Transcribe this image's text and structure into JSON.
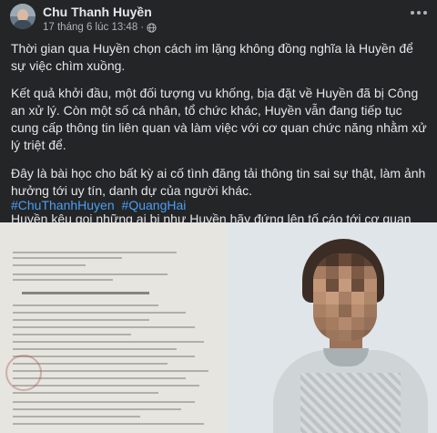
{
  "post": {
    "author": "Chu Thanh Huyền",
    "timestamp": "17 tháng 6 lúc 13:48",
    "separator": "·",
    "privacy_icon": "globe-icon",
    "more_icon": "more-horizontal-icon"
  },
  "content": {
    "paragraphs": [
      "Thời gian qua Huyền chọn cách im lặng không đồng nghĩa là Huyền để sự việc chìm xuồng.",
      "Kết quả khởi đầu, một đối tượng vu khống, bịa đặt về Huyền đã bị Công an xử lý. Còn một số cá nhân, tổ chức khác, Huyền vẫn đang tiếp tục cung cấp thông tin liên quan và làm việc với cơ quan chức năng nhằm xử lý triệt để.",
      "Đây là bài học cho bất kỳ ai cố tình đăng tải thông tin sai sự thật, làm ảnh hưởng tới uy tín, danh dự của người khác.",
      "Huyền kêu gọi những ai bị như Huyền hãy đứng lên tố cáo tới cơ quan chức năng. Pháp luật là để thượng tôn chứ không phải mơ đùa giỡn."
    ],
    "hashtags": [
      "#ChuThanhHuyen",
      "#QuangHai"
    ]
  },
  "colors": {
    "background": "#242526",
    "text": "#e4e6eb",
    "secondary_text": "#b0b3b8",
    "link": "#4a9ff5"
  }
}
